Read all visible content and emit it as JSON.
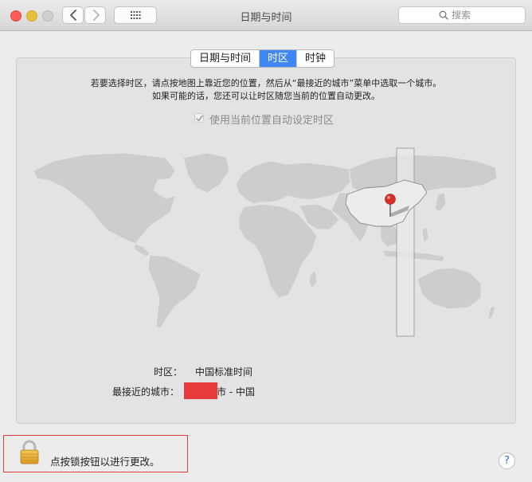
{
  "window": {
    "title": "日期与时间"
  },
  "search": {
    "placeholder": "搜索"
  },
  "tabs": [
    {
      "label": "日期与时间",
      "active": false
    },
    {
      "label": "时区",
      "active": true
    },
    {
      "label": "时钟",
      "active": false
    }
  ],
  "instructions": {
    "line1": "若要选择时区，请点按地图上靠近您的位置，然后从“最接近的城市”菜单中选取一个城市。",
    "line2": "如果可能的话，您还可以让时区随您当前的位置自动更改。"
  },
  "auto_timezone": {
    "label": "使用当前位置自动设定时区",
    "checked": true,
    "enabled": false
  },
  "timezone": {
    "label": "时区：",
    "value": "中国标准时间"
  },
  "closest_city": {
    "label": "最接近的城市：",
    "value": "市 - 中国"
  },
  "lock": {
    "text": "点按锁按钮以进行更改。"
  },
  "help": {
    "label": "?"
  },
  "colors": {
    "accent": "#3f87f5",
    "pin": "#d62d2d",
    "annotation_border": "#e03c3c",
    "redaction": "#e83b3b"
  },
  "icons": [
    "chevron-left-icon",
    "chevron-right-icon",
    "grid-icon",
    "search-icon",
    "checkmark-icon",
    "map-pin-icon",
    "lock-icon"
  ]
}
